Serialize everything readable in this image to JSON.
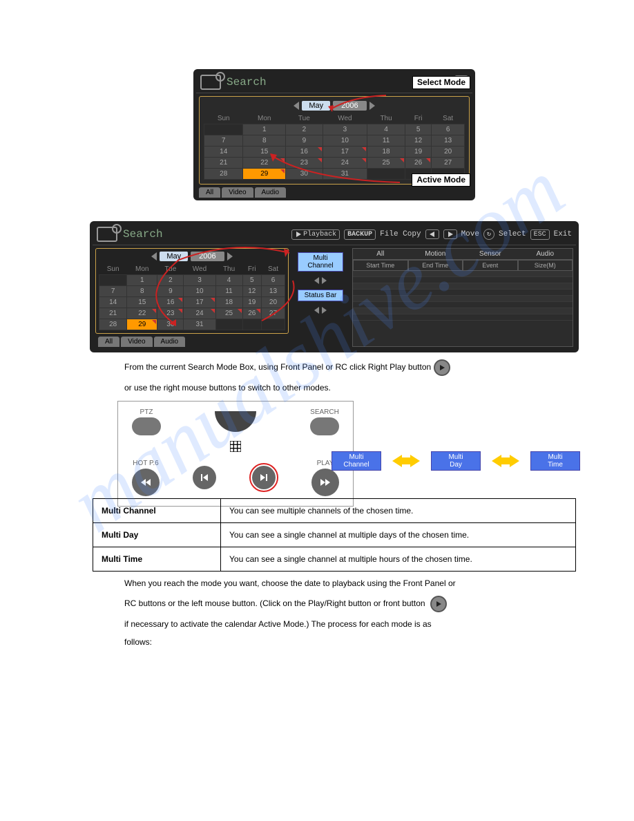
{
  "title": "Search",
  "month": "May",
  "year": "2006",
  "days": [
    "Sun",
    "Mon",
    "Tue",
    "Wed",
    "Thu",
    "Fri",
    "Sat"
  ],
  "weeks": [
    [
      "",
      "1",
      "2",
      "3",
      "4",
      "5",
      "6"
    ],
    [
      "7",
      "8",
      "9",
      "10",
      "11",
      "12",
      "13"
    ],
    [
      "14",
      "15",
      "16",
      "17",
      "18",
      "19",
      "20"
    ],
    [
      "21",
      "22",
      "23",
      "24",
      "25",
      "26",
      "27"
    ],
    [
      "28",
      "29",
      "30",
      "31",
      "",
      "",
      ""
    ]
  ],
  "marked": [
    "16",
    "17",
    "22",
    "23",
    "24",
    "25",
    "26",
    "29"
  ],
  "selected_day": "29",
  "tabs": [
    "All",
    "Video",
    "Audio"
  ],
  "callout_select": "Select\nMode",
  "callout_active": "Active\nMode",
  "wide_tabs": [
    "All",
    "Motion",
    "Sensor",
    "Audio"
  ],
  "wide_cols": [
    "Start Time",
    "End Time",
    "Event",
    "Size(M)"
  ],
  "toolbar": {
    "playback": "Playback",
    "backup": "BACKUP",
    "filecopy": "File Copy",
    "move": "Move",
    "select": "Select",
    "esc": "ESC",
    "exit": "Exit"
  },
  "mid": {
    "multi_channel": "Multi\nChannel",
    "status_bar": "Status Bar"
  },
  "para1": "From the current Search Mode Box, using Front Panel or RC click Right Play button",
  "para2": "or use the right mouse buttons to switch to other modes.",
  "modes": [
    "Multi\nChannel",
    "Multi\nDay",
    "Multi\nTime"
  ],
  "remote": {
    "ptz": "PTZ",
    "search": "SEARCH",
    "hot": "HOT P.6",
    "play": "PLAY"
  },
  "table": [
    [
      "Multi Channel",
      "You can see multiple channels of the chosen time."
    ],
    [
      "Multi Day",
      "You can see a single channel at multiple days of the chosen time."
    ],
    [
      "Multi Time",
      "You can see a single channel at multiple hours of the chosen time."
    ]
  ],
  "after1": "When you reach the mode you want, choose the date to playback using the Front Panel or",
  "after2": "RC buttons or the left mouse button. (Click on the Play/Right button            or front button",
  "after3": "if necessary to activate the calendar Active Mode.)  The process for each mode is as",
  "after4": "follows:",
  "watermark": "manualshive.com"
}
